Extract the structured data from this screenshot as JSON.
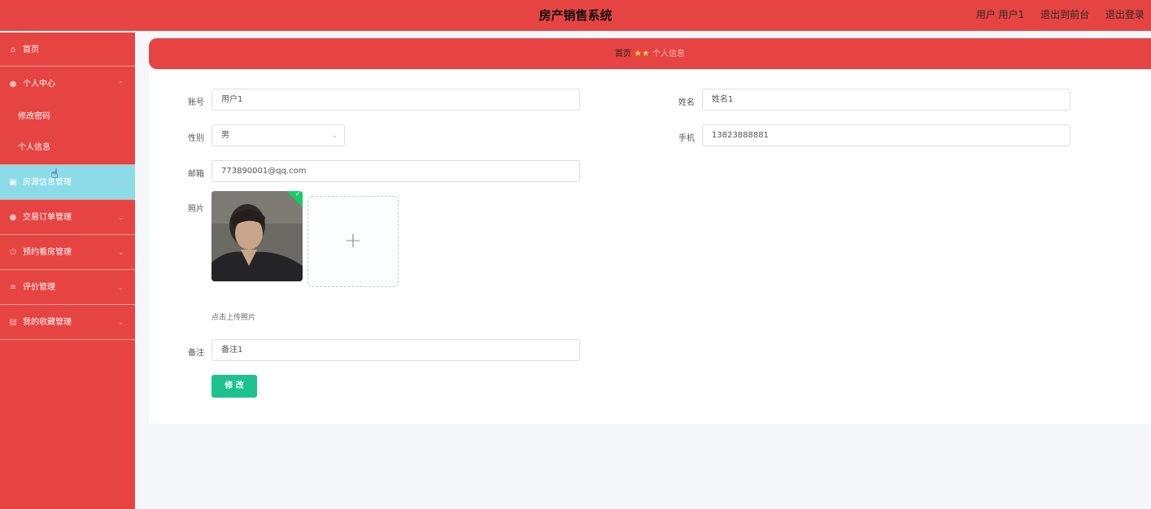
{
  "header": {
    "title": "房产销售系统",
    "user_label": "用户 用户1",
    "to_front": "退出到前台",
    "logout": "退出登录"
  },
  "sidebar": {
    "items": [
      {
        "label": "首页",
        "icon": "home-icon"
      },
      {
        "label": "个人中心",
        "icon": "user-icon",
        "expanded": true,
        "children": [
          {
            "label": "修改密码"
          },
          {
            "label": "个人信息"
          }
        ]
      },
      {
        "label": "房源信息管理",
        "icon": "briefcase-icon",
        "active": true
      },
      {
        "label": "交易订单管理",
        "icon": "user-icon"
      },
      {
        "label": "预约看房管理",
        "icon": "power-icon"
      },
      {
        "label": "评价管理",
        "icon": "list-icon"
      },
      {
        "label": "我的收藏管理",
        "icon": "print-icon"
      }
    ]
  },
  "breadcrumb": {
    "home": "首页",
    "current": "个人信息"
  },
  "form": {
    "account_label": "账号",
    "account_value": "用户1",
    "name_label": "姓名",
    "name_value": "姓名1",
    "gender_label": "性别",
    "gender_value": "男",
    "phone_label": "手机",
    "phone_value": "13823888881",
    "email_label": "邮箱",
    "email_value": "773890001@qq.com",
    "photo_label": "照片",
    "upload_hint": "点击上传照片",
    "remark_label": "备注",
    "remark_value": "备注1",
    "submit_label": "修 改"
  },
  "colors": {
    "primary": "#e64442",
    "active_menu": "#8cdbe9",
    "button": "#1ec28e"
  }
}
